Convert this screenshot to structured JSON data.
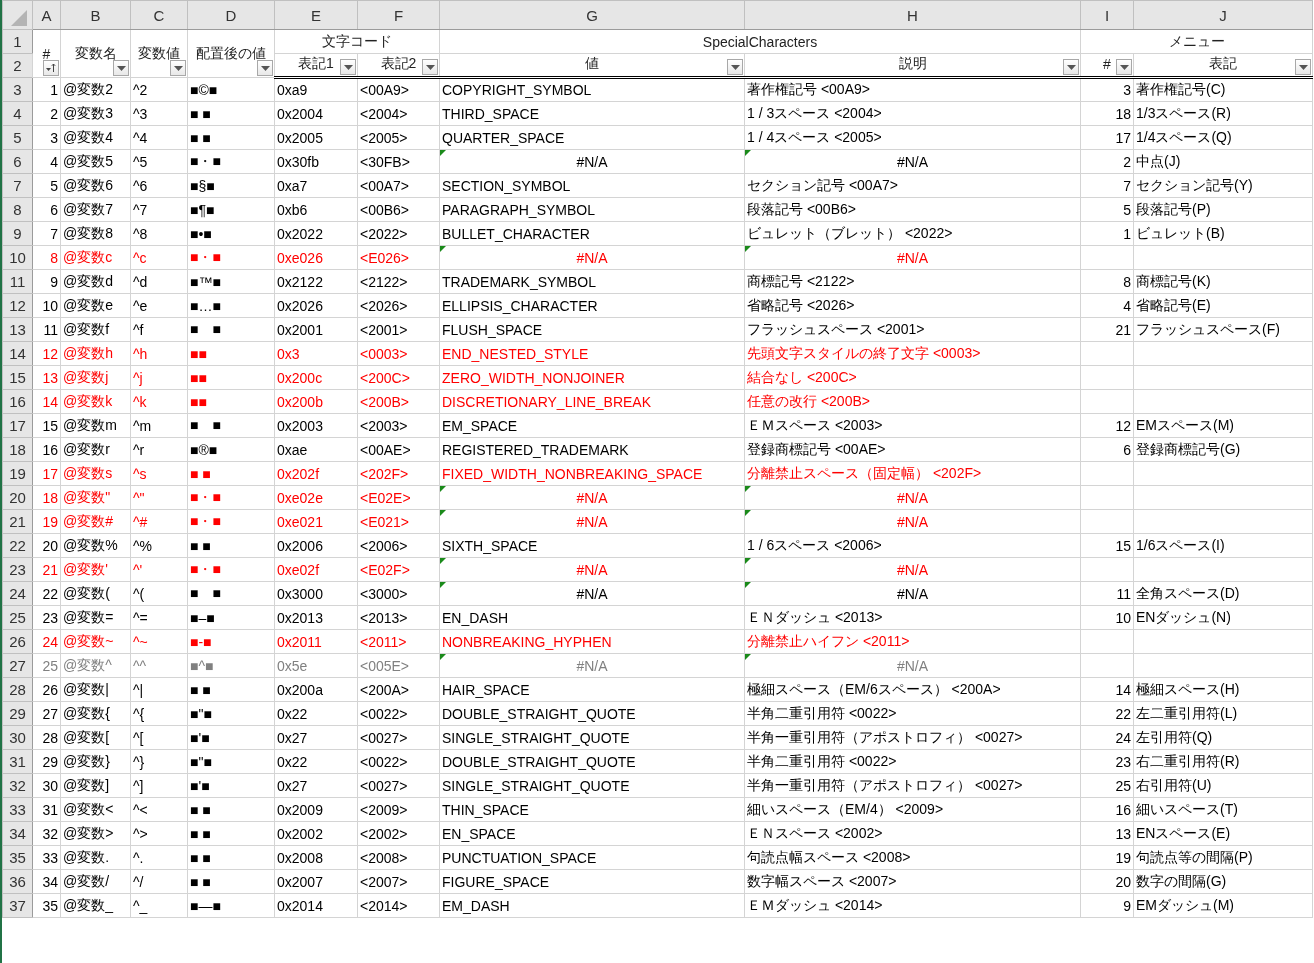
{
  "column_letters": [
    "A",
    "B",
    "C",
    "D",
    "E",
    "F",
    "G",
    "H",
    "I",
    "J"
  ],
  "row_numbers": [
    "1",
    "2",
    "3",
    "4",
    "5",
    "6",
    "7",
    "8",
    "9",
    "10",
    "11",
    "12",
    "13",
    "14",
    "15",
    "16",
    "17",
    "18",
    "19",
    "20",
    "21",
    "22",
    "23",
    "24",
    "25",
    "26",
    "27",
    "28",
    "29",
    "30",
    "31",
    "32",
    "33",
    "34",
    "35",
    "36",
    "37"
  ],
  "header": [
    {
      "label": "#",
      "kind": "sorted"
    },
    {
      "label": "変数名",
      "kind": "dropdown"
    },
    {
      "label": "変数値",
      "kind": "dropdown"
    },
    {
      "label": "配置後の値",
      "kind": "dropdown"
    },
    {
      "group": "文字コード",
      "fields": [
        {
          "label": "表記1",
          "kind": "dropdown"
        },
        {
          "label": "表記2",
          "kind": "dropdown"
        }
      ]
    },
    {
      "group": "SpecialCharacters",
      "fields": [
        {
          "label": "値",
          "kind": "dropdown"
        },
        {
          "label": "説明",
          "kind": "dropdown"
        }
      ]
    },
    {
      "group": "メニュー",
      "fields": [
        {
          "label": "#",
          "kind": "dropdown"
        },
        {
          "label": "表記",
          "kind": "dropdown"
        }
      ]
    }
  ],
  "rows": [
    {
      "a": "1",
      "b": "@変数2",
      "c": "^2",
      "d": "■©■",
      "e": "0xa9",
      "f": "<00A9>",
      "g": "COPYRIGHT_SYMBOL",
      "h": "著作権記号 <00A9>",
      "i": "3",
      "j": "著作権記号(C)",
      "color": "#000000",
      "na_flag": false
    },
    {
      "a": "2",
      "b": "@変数3",
      "c": "^3",
      "d": "■  ■",
      "e": "0x2004",
      "f": "<2004>",
      "g": "THIRD_SPACE",
      "h": "1 / 3スペース <2004>",
      "i": "18",
      "j": "1/3スペース(R)",
      "color": "#000000",
      "na_flag": false
    },
    {
      "a": "3",
      "b": "@変数4",
      "c": "^4",
      "d": "■  ■",
      "e": "0x2005",
      "f": "<2005>",
      "g": "QUARTER_SPACE",
      "h": "1 / 4スペース <2005>",
      "i": "17",
      "j": "1/4スペース(Q)",
      "color": "#000000",
      "na_flag": false
    },
    {
      "a": "4",
      "b": "@変数5",
      "c": "^5",
      "d": "■・■",
      "e": "0x30fb",
      "f": "<30FB>",
      "g": "#N/A",
      "h": "#N/A",
      "i": "2",
      "j": "中点(J)",
      "color": "#000000",
      "na_flag": true
    },
    {
      "a": "5",
      "b": "@変数6",
      "c": "^6",
      "d": "■§■",
      "e": "0xa7",
      "f": "<00A7>",
      "g": "SECTION_SYMBOL",
      "h": "セクション記号 <00A7>",
      "i": "7",
      "j": "セクション記号(Y)",
      "color": "#000000",
      "na_flag": false
    },
    {
      "a": "6",
      "b": "@変数7",
      "c": "^7",
      "d": "■¶■",
      "e": "0xb6",
      "f": "<00B6>",
      "g": "PARAGRAPH_SYMBOL",
      "h": "段落記号 <00B6>",
      "i": "5",
      "j": "段落記号(P)",
      "color": "#000000",
      "na_flag": false
    },
    {
      "a": "7",
      "b": "@変数8",
      "c": "^8",
      "d": "■•■",
      "e": "0x2022",
      "f": "<2022>",
      "g": "BULLET_CHARACTER",
      "h": "ビュレット（ブレット） <2022>",
      "i": "1",
      "j": "ビュレット(B)",
      "color": "#000000",
      "na_flag": false
    },
    {
      "a": "8",
      "b": "@変数c",
      "c": "^c",
      "d": "■・■",
      "e": "0xe026",
      "f": "<E026>",
      "g": "#N/A",
      "h": "#N/A",
      "color": "#ff0000",
      "na_flag": true
    },
    {
      "a": "9",
      "b": "@変数d",
      "c": "^d",
      "d": "■™■",
      "e": "0x2122",
      "f": "<2122>",
      "g": "TRADEMARK_SYMBOL",
      "h": "商標記号 <2122>",
      "i": "8",
      "j": "商標記号(K)",
      "color": "#000000",
      "na_flag": false
    },
    {
      "a": "10",
      "b": "@変数e",
      "c": "^e",
      "d": "■…■",
      "e": "0x2026",
      "f": "<2026>",
      "g": "ELLIPSIS_CHARACTER",
      "h": "省略記号 <2026>",
      "i": "4",
      "j": "省略記号(E)",
      "color": "#000000",
      "na_flag": false
    },
    {
      "a": "11",
      "b": "@変数f",
      "c": "^f",
      "d": "■　■",
      "e": "0x2001",
      "f": "<2001>",
      "g": "FLUSH_SPACE",
      "h": "フラッシュスペース <2001>",
      "i": "21",
      "j": "フラッシュスペース(F)",
      "color": "#000000",
      "na_flag": false
    },
    {
      "a": "12",
      "b": "@変数h",
      "c": "^h",
      "d": "■■",
      "e": "0x3",
      "f": "<0003>",
      "g": "END_NESTED_STYLE",
      "h": "先頭文字スタイルの終了文字 <0003>",
      "color": "#ff0000",
      "na_flag": false
    },
    {
      "a": "13",
      "b": "@変数j",
      "c": "^j",
      "d": "■■",
      "e": "0x200c",
      "f": "<200C>",
      "g": "ZERO_WIDTH_NONJOINER",
      "h": "結合なし <200C>",
      "color": "#ff0000",
      "na_flag": false
    },
    {
      "a": "14",
      "b": "@変数k",
      "c": "^k",
      "d": "■■",
      "e": "0x200b",
      "f": "<200B>",
      "g": "DISCRETIONARY_LINE_BREAK",
      "h": "任意の改行 <200B>",
      "color": "#ff0000",
      "na_flag": false
    },
    {
      "a": "15",
      "b": "@変数m",
      "c": "^m",
      "d": "■　■",
      "e": "0x2003",
      "f": "<2003>",
      "g": "EM_SPACE",
      "h": "ＥＭスペース <2003>",
      "i": "12",
      "j": "EMスペース(M)",
      "color": "#000000",
      "na_flag": false
    },
    {
      "a": "16",
      "b": "@変数r",
      "c": "^r",
      "d": "■®■",
      "e": "0xae",
      "f": "<00AE>",
      "g": "REGISTERED_TRADEMARK",
      "h": "登録商標記号 <00AE>",
      "i": "6",
      "j": "登録商標記号(G)",
      "color": "#000000",
      "na_flag": false
    },
    {
      "a": "17",
      "b": "@変数s",
      "c": "^s",
      "d": "■ ■",
      "e": "0x202f",
      "f": "<202F>",
      "g": "FIXED_WIDTH_NONBREAKING_SPACE",
      "h": "分離禁止スペース（固定幅） <202F>",
      "color": "#ff0000",
      "na_flag": false
    },
    {
      "a": "18",
      "b": "@変数\"",
      "c": "^\"",
      "d": "■・■",
      "e": "0xe02e",
      "f": "<E02E>",
      "g": "#N/A",
      "h": "#N/A",
      "color": "#ff0000",
      "na_flag": true
    },
    {
      "a": "19",
      "b": "@変数#",
      "c": "^#",
      "d": "■・■",
      "e": "0xe021",
      "f": "<E021>",
      "g": "#N/A",
      "h": "#N/A",
      "color": "#ff0000",
      "na_flag": true
    },
    {
      "a": "20",
      "b": "@変数%",
      "c": "^%",
      "d": "■  ■",
      "e": "0x2006",
      "f": "<2006>",
      "g": "SIXTH_SPACE",
      "h": "1 / 6スペース <2006>",
      "i": "15",
      "j": "1/6スペース(I)",
      "color": "#000000",
      "na_flag": false
    },
    {
      "a": "21",
      "b": "@変数'",
      "c": "^'",
      "d": "■・■",
      "e": "0xe02f",
      "f": "<E02F>",
      "g": "#N/A",
      "h": "#N/A",
      "color": "#ff0000",
      "na_flag": true
    },
    {
      "a": "22",
      "b": "@変数(",
      "c": "^(",
      "d": "■　■",
      "e": "0x3000",
      "f": "<3000>",
      "g": "#N/A",
      "h": "#N/A",
      "i": "11",
      "j": "全角スペース(D)",
      "color": "#000000",
      "na_flag": true
    },
    {
      "a": "23",
      "b": "@変数=",
      "c": "^=",
      "d": "■–■",
      "e": "0x2013",
      "f": "<2013>",
      "g": "EN_DASH",
      "h": "ＥＮダッシュ <2013>",
      "i": "10",
      "j": "ENダッシュ(N)",
      "color": "#000000",
      "na_flag": false
    },
    {
      "a": "24",
      "b": "@変数~",
      "c": "^~",
      "d": "■-■",
      "e": "0x2011",
      "f": "<2011>",
      "g": "NONBREAKING_HYPHEN",
      "h": "分離禁止ハイフン <2011>",
      "color": "#ff0000",
      "na_flag": false
    },
    {
      "a": "25",
      "b": "@変数^",
      "c": "^^",
      "d": "■^■",
      "e": "0x5e",
      "f": "<005E>",
      "g": "#N/A",
      "h": "#N/A",
      "color": "#808080",
      "na_flag": true
    },
    {
      "a": "26",
      "b": "@変数|",
      "c": "^|",
      "d": "■  ■",
      "e": "0x200a",
      "f": "<200A>",
      "g": "HAIR_SPACE",
      "h": "極細スペース（EM/6スペース） <200A>",
      "i": "14",
      "j": "極細スペース(H)",
      "color": "#000000",
      "na_flag": false
    },
    {
      "a": "27",
      "b": "@変数{",
      "c": "^{",
      "d": "■\"■",
      "e": "0x22",
      "f": "<0022>",
      "g": "DOUBLE_STRAIGHT_QUOTE",
      "h": "半角二重引用符 <0022>",
      "i": "22",
      "j": "左二重引用符(L)",
      "color": "#000000",
      "na_flag": false
    },
    {
      "a": "28",
      "b": "@変数[",
      "c": "^[",
      "d": "■'■",
      "e": "0x27",
      "f": "<0027>",
      "g": "SINGLE_STRAIGHT_QUOTE",
      "h": "半角一重引用符（アポストロフィ） <0027>",
      "i": "24",
      "j": "左引用符(Q)",
      "color": "#000000",
      "na_flag": false
    },
    {
      "a": "29",
      "b": "@変数}",
      "c": "^}",
      "d": "■\"■",
      "e": "0x22",
      "f": "<0022>",
      "g": "DOUBLE_STRAIGHT_QUOTE",
      "h": "半角二重引用符 <0022>",
      "i": "23",
      "j": "右二重引用符(R)",
      "color": "#000000",
      "na_flag": false
    },
    {
      "a": "30",
      "b": "@変数]",
      "c": "^]",
      "d": "■'■",
      "e": "0x27",
      "f": "<0027>",
      "g": "SINGLE_STRAIGHT_QUOTE",
      "h": "半角一重引用符（アポストロフィ） <0027>",
      "i": "25",
      "j": "右引用符(U)",
      "color": "#000000",
      "na_flag": false
    },
    {
      "a": "31",
      "b": "@変数<",
      "c": "^<",
      "d": "■  ■",
      "e": "0x2009",
      "f": "<2009>",
      "g": "THIN_SPACE",
      "h": "細いスペース（EM/4） <2009>",
      "i": "16",
      "j": "細いスペース(T)",
      "color": "#000000",
      "na_flag": false
    },
    {
      "a": "32",
      "b": "@変数>",
      "c": "^>",
      "d": "■  ■",
      "e": "0x2002",
      "f": "<2002>",
      "g": "EN_SPACE",
      "h": "ＥＮスペース <2002>",
      "i": "13",
      "j": "ENスペース(E)",
      "color": "#000000",
      "na_flag": false
    },
    {
      "a": "33",
      "b": "@変数.",
      "c": "^.",
      "d": "■  ■",
      "e": "0x2008",
      "f": "<2008>",
      "g": "PUNCTUATION_SPACE",
      "h": "句読点幅スペース <2008>",
      "i": "19",
      "j": "句読点等の間隔(P)",
      "color": "#000000",
      "na_flag": false
    },
    {
      "a": "34",
      "b": "@変数/",
      "c": "^/",
      "d": "■  ■",
      "e": "0x2007",
      "f": "<2007>",
      "g": "FIGURE_SPACE",
      "h": "数字幅スペース <2007>",
      "i": "20",
      "j": "数字の間隔(G)",
      "color": "#000000",
      "na_flag": false
    },
    {
      "a": "35",
      "b": "@変数_",
      "c": "^_",
      "d": "■—■",
      "e": "0x2014",
      "f": "<2014>",
      "g": "EM_DASH",
      "h": "ＥＭダッシュ <2014>",
      "i": "9",
      "j": "EMダッシュ(M)",
      "color": "#000000",
      "na_flag": false
    }
  ]
}
